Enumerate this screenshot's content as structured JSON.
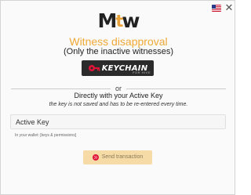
{
  "header": {
    "language_flag": "us-flag-icon",
    "close_symbol": "✕"
  },
  "logo": {
    "left": "M",
    "middle": "t",
    "right": "w"
  },
  "title": "Witness disapproval",
  "subtitle": "(Only the inactive witnesses)",
  "keychain_button": {
    "label": "KEYCHAIN",
    "sublabel": "FOR HIVE"
  },
  "separator_text": "or",
  "active_key_section": {
    "heading": "Directly with your Active Key",
    "note": "the key is not saved and has to be re-entered every time.",
    "input_placeholder": "Active Key",
    "input_value": "",
    "hint": "In your wallet: [keys & permissions]"
  },
  "send_button": {
    "label": "Send transaction",
    "icon": "hive-icon"
  },
  "colors": {
    "accent": "#f0a936",
    "keychain_bg": "#2b2b2b",
    "keychain_red": "#e31337",
    "send_bg": "#f6dba7"
  }
}
